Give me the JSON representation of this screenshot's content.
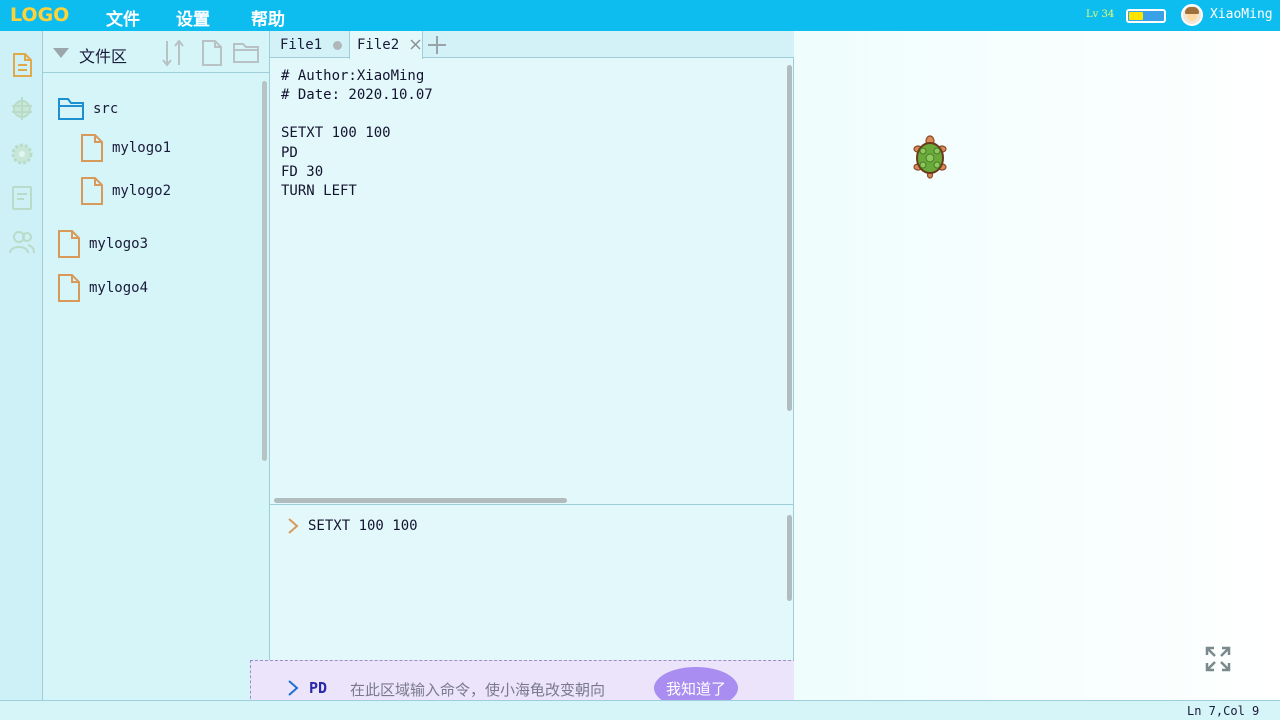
{
  "app": {
    "logo": "LOGO",
    "menu": [
      "文件",
      "设置",
      "帮助"
    ],
    "level": "Lv 34",
    "battery_fraction": 0.4,
    "username": "XiaoMing"
  },
  "activity_icons": [
    "file-icon",
    "bug-icon",
    "gear-icon",
    "book-icon",
    "users-icon"
  ],
  "explorer": {
    "title": "文件区",
    "items": [
      {
        "label": "src",
        "type": "folder",
        "indent": 0
      },
      {
        "label": "mylogo1",
        "type": "file",
        "indent": 1
      },
      {
        "label": "mylogo2",
        "type": "file",
        "indent": 1
      },
      {
        "label": "mylogo3",
        "type": "file",
        "indent": 0
      },
      {
        "label": "mylogo4",
        "type": "file",
        "indent": 0
      }
    ]
  },
  "editor": {
    "tabs": [
      {
        "label": "File1",
        "active": false
      },
      {
        "label": "File2",
        "active": true
      }
    ],
    "code_lines": [
      "# Author:XiaoMing",
      "# Date: 2020.10.07",
      "",
      "SETXT 100 100",
      "PD",
      "FD 30",
      "TURN LEFT"
    ],
    "console_lines": [
      "SETXT 100 100"
    ]
  },
  "input": {
    "command": "PD",
    "hint": "在此区域输入命令，使小海龟改变朝向",
    "got_it": "我知道了"
  },
  "status": {
    "position": "Ln 7,Col 9"
  },
  "colors": {
    "topbar": "#0ebdf0",
    "accent_orange": "#d89a5a",
    "folder_blue": "#1e8fd0",
    "highlight_purple": "#a98df0"
  }
}
